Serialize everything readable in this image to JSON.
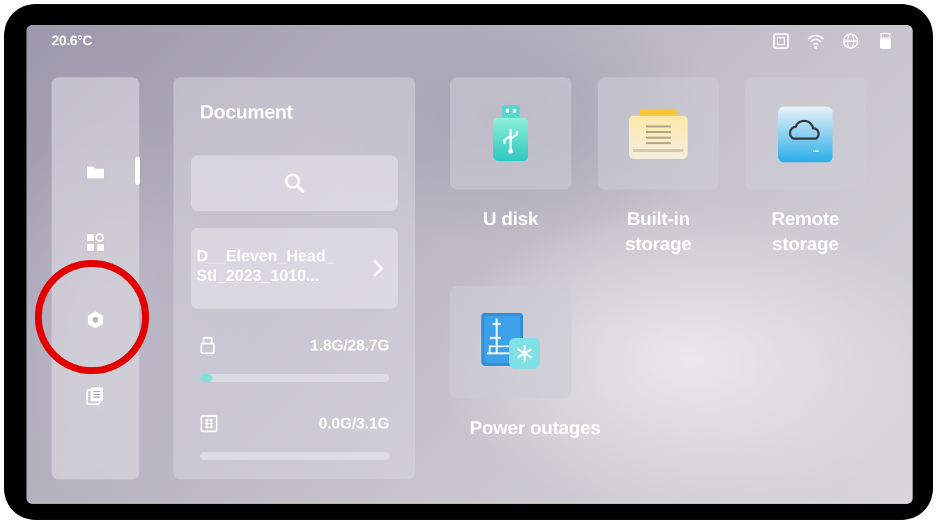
{
  "status_bar": {
    "temperature": "20.6°C",
    "icons": [
      "storage-icon",
      "wifi-icon",
      "globe-icon",
      "usb-icon"
    ]
  },
  "sidebar": {
    "items": [
      {
        "name": "files",
        "icon": "folder-icon",
        "active": true
      },
      {
        "name": "apps",
        "icon": "apps-grid-icon",
        "active": false
      },
      {
        "name": "settings",
        "icon": "settings-hexagon-icon",
        "active": false
      },
      {
        "name": "logs",
        "icon": "document-stack-icon",
        "active": false
      }
    ]
  },
  "document_panel": {
    "title": "Document",
    "search_icon": "search-icon",
    "recent_file": {
      "name": "D__Eleven_Head_\nStl_2023_1010...",
      "chevron": "chevron-right-icon"
    },
    "usb_storage": {
      "usage": "1.8G/28.7G",
      "fraction": 0.063,
      "icon": "usb-icon"
    },
    "internal_storage": {
      "usage": "0.0G/3.1G",
      "fraction": 0.0,
      "icon": "chip-icon"
    }
  },
  "tiles": [
    {
      "label": "U disk",
      "icon": "usb-drive-icon"
    },
    {
      "label": "Built-in storage",
      "icon": "built-in-storage-icon"
    },
    {
      "label": "Remote storage",
      "icon": "cloud-storage-icon"
    },
    {
      "label": "Power outages",
      "icon": "power-outage-icon"
    }
  ],
  "colors": {
    "accent_teal": "#7fe0dc",
    "highlight_red": "#e30000"
  }
}
